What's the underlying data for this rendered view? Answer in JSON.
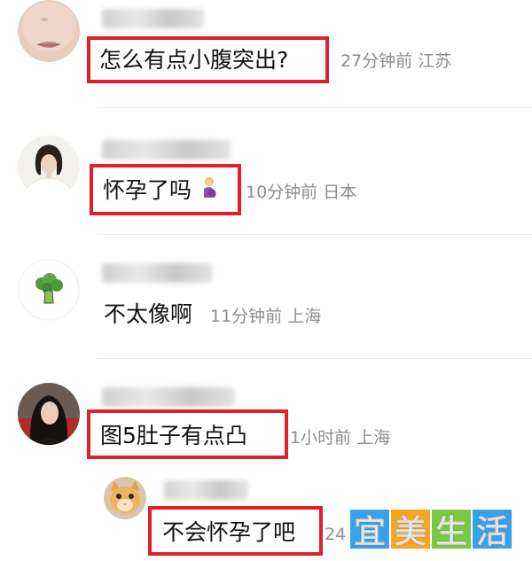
{
  "comments": [
    {
      "text": "怎么有点小腹突出?",
      "time": "27分钟前",
      "location": "江苏",
      "avatar": "woman-lips-closeup-avatar",
      "highlighted": true
    },
    {
      "text": "怀孕了吗",
      "emoji": "pregnant-woman-emoji",
      "time": "10分钟前",
      "location": "日本",
      "avatar": "woman-portrait-avatar",
      "highlighted": true
    },
    {
      "text": "不太像啊",
      "time": "11分钟前",
      "location": "上海",
      "avatar": "broccoli-avatar",
      "highlighted": false
    },
    {
      "text": "图5肚子有点凸",
      "time": "1小时前",
      "location": "上海",
      "avatar": "dark-hair-woman-avatar",
      "highlighted": true
    },
    {
      "text": "不会怀孕了吧",
      "time": "24",
      "avatar": "cat-avatar",
      "highlighted": true,
      "reply": true
    }
  ],
  "watermark": {
    "chars": [
      "宜",
      "美",
      "生",
      "活"
    ],
    "colors": [
      "#3aa0e8",
      "#f5a623",
      "#7ac943",
      "#3aa0e8"
    ]
  },
  "colors": {
    "highlight_border": "#e0202a",
    "meta_text": "#8d8d8d",
    "body_text": "#111111"
  }
}
